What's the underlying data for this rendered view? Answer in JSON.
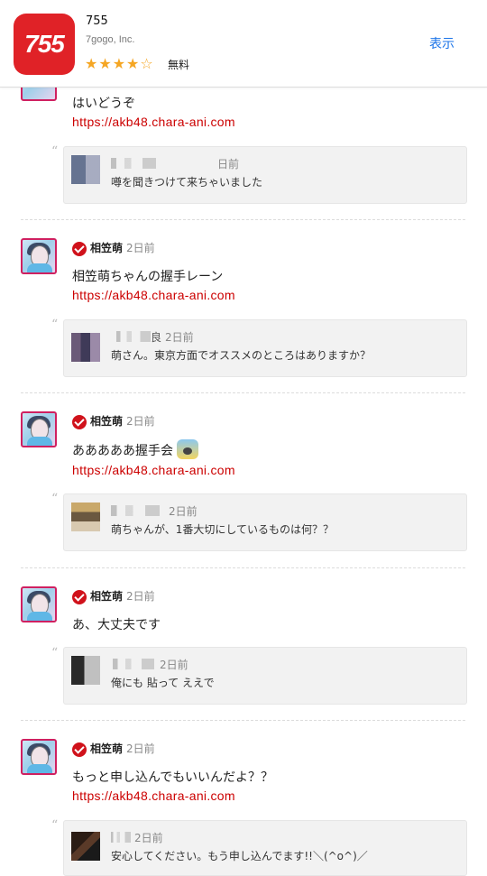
{
  "app_banner": {
    "icon_text": "755",
    "name": "755",
    "developer": "7gogo, Inc.",
    "rating_stars": "★★★★",
    "rating_empty_star": "☆",
    "rating_value": 4,
    "price": "無料",
    "view_button": "表示",
    "accent_color": "#e02227",
    "link_color": "#1a73e8"
  },
  "feed": {
    "quote_mark": "“",
    "posts": [
      {
        "text": "はいどうぞ",
        "link": "https://akb48.chara-ani.com",
        "reply": {
          "time": "日前",
          "text": "噂を聞きつけて来ちゃいました"
        }
      },
      {
        "poster": "相笠萌",
        "time": "2日前",
        "text": "相笠萌ちゃんの握手レーン",
        "link": "https://akb48.chara-ani.com",
        "reply": {
          "name_suffix": "良",
          "time": "2日前",
          "text": "萌さん。東京方面でオススメのところはありますか？"
        }
      },
      {
        "poster": "相笠萌",
        "time": "2日前",
        "text": "あああああ握手会",
        "emoji": "scream-emoji",
        "link": "https://akb48.chara-ani.com",
        "reply": {
          "time": "2日前",
          "text": "萌ちゃんが、1番大切にしているものは何？？"
        }
      },
      {
        "poster": "相笠萌",
        "time": "2日前",
        "text": "あ、大丈夫です",
        "reply": {
          "time": "2日前",
          "text": "俺にも 貼って ええで"
        }
      },
      {
        "poster": "相笠萌",
        "time": "2日前",
        "text": "もっと申し込んでもいいんだよ？？",
        "link": "https://akb48.chara-ani.com",
        "reply": {
          "time": "2日前",
          "text": "安心してください。もう申し込んでます!!＼(^o^)／"
        }
      }
    ]
  },
  "colors": {
    "link": "#cc0000",
    "verified_badge": "#d0121b",
    "avatar_border": "#d02060"
  }
}
